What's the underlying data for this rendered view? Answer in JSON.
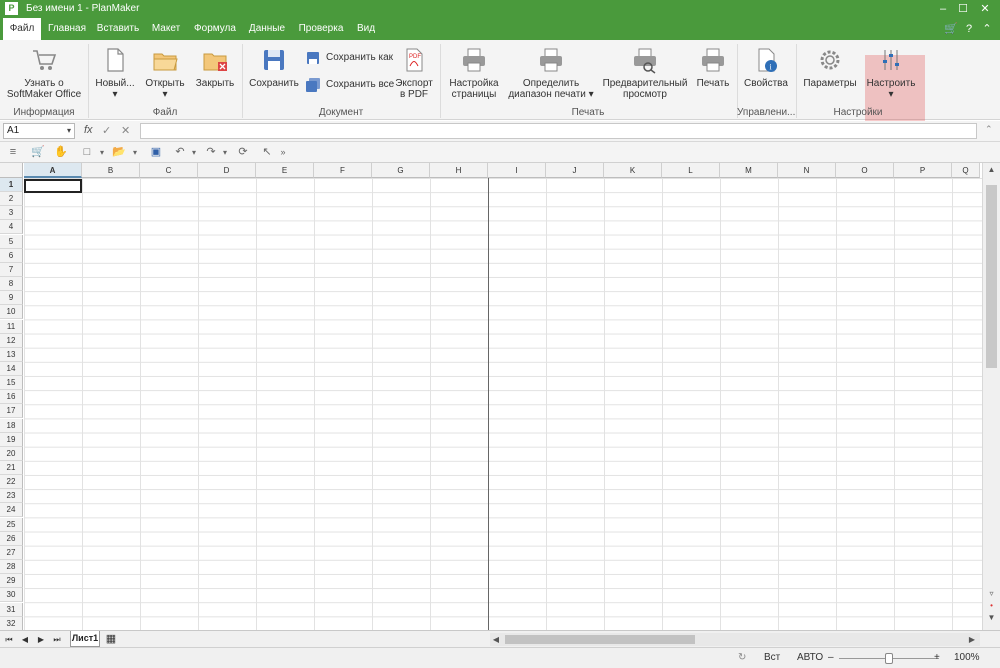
{
  "window": {
    "title": "Без имени 1 - PlanMaker",
    "app_icon": "P"
  },
  "menu": {
    "tabs": [
      "Файл",
      "Главная",
      "Вставить",
      "Макет",
      "Формула",
      "Данные",
      "Проверка",
      "Вид"
    ],
    "active_tab": "Файл"
  },
  "ribbon": {
    "info": {
      "learn_label_line1": "Узнать о",
      "learn_label_line2": "SoftMaker Office",
      "group_label": "Информация"
    },
    "file": {
      "new_label": "Новый...",
      "open_label": "Открыть",
      "close_label": "Закрыть",
      "group_label": "Файл"
    },
    "document": {
      "save_label": "Сохранить",
      "save_as_label": "Сохранить как",
      "save_all_label": "Сохранить все",
      "export_pdf_line1": "Экспорт",
      "export_pdf_line2": "в PDF",
      "group_label": "Документ"
    },
    "print": {
      "page_setup_line1": "Настройка",
      "page_setup_line2": "страницы",
      "print_range_line1": "Определить",
      "print_range_line2": "диапазон печати",
      "preview_line1": "Предварительный",
      "preview_line2": "просмотр",
      "print_label": "Печать",
      "group_label": "Печать"
    },
    "manage": {
      "properties_label": "Свойства",
      "group_label": "Управлени..."
    },
    "settings": {
      "options_label": "Параметры",
      "customize_label": "Настроить",
      "group_label": "Настройки"
    }
  },
  "formula_bar": {
    "cell_ref": "A1",
    "fx_label": "fx",
    "formula": ""
  },
  "grid": {
    "columns": [
      "A",
      "B",
      "C",
      "D",
      "E",
      "F",
      "G",
      "H",
      "I",
      "J",
      "K",
      "L",
      "M",
      "N",
      "O",
      "P",
      "Q"
    ],
    "rows": [
      "1",
      "2",
      "3",
      "4",
      "5",
      "6",
      "7",
      "8",
      "9",
      "10",
      "11",
      "12",
      "13",
      "14",
      "15",
      "16",
      "17",
      "18",
      "19",
      "20",
      "21",
      "22",
      "23",
      "24",
      "25",
      "26",
      "27",
      "28",
      "29",
      "30",
      "31",
      "32"
    ],
    "active_cell": "A1"
  },
  "sheets": {
    "tabs": [
      "Лист1"
    ],
    "active": "Лист1"
  },
  "status": {
    "insert_mode": "Вст",
    "auto_label": "АВТО",
    "zoom": "100%",
    "zoom_fraction": 0.5
  }
}
